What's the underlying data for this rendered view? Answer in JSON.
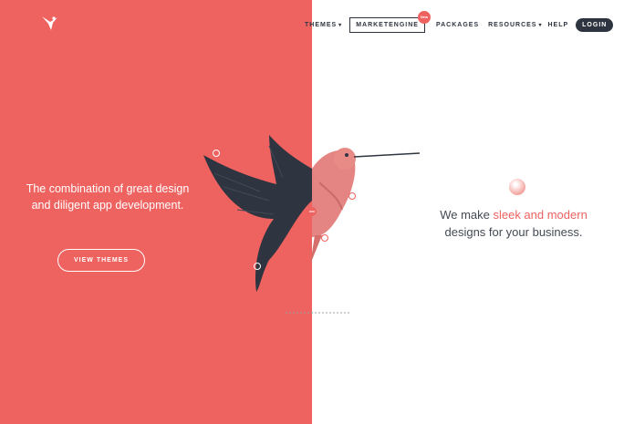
{
  "nav": {
    "items": [
      {
        "label": "THEMES",
        "has_dropdown": true
      },
      {
        "label": "MARKETENGINE",
        "badge": "New",
        "boxed": true
      },
      {
        "label": "PACKAGES"
      },
      {
        "label": "RESOURCES",
        "has_dropdown": true
      },
      {
        "label": "HELP"
      },
      {
        "label": "LOGIN",
        "pill": true
      }
    ]
  },
  "hero": {
    "left_text": "The combination of great design and diligent app development.",
    "button_label": "VIEW THEMES",
    "right_text_before": "We make ",
    "right_text_highlight": "sleek and modern",
    "right_text_after": " designs for your business."
  },
  "colors": {
    "accent": "#EE6260",
    "dark": "#2f3540",
    "background": "#ffffff"
  },
  "icons": [
    "hummingbird-logo-icon",
    "chevron-down-icon"
  ]
}
